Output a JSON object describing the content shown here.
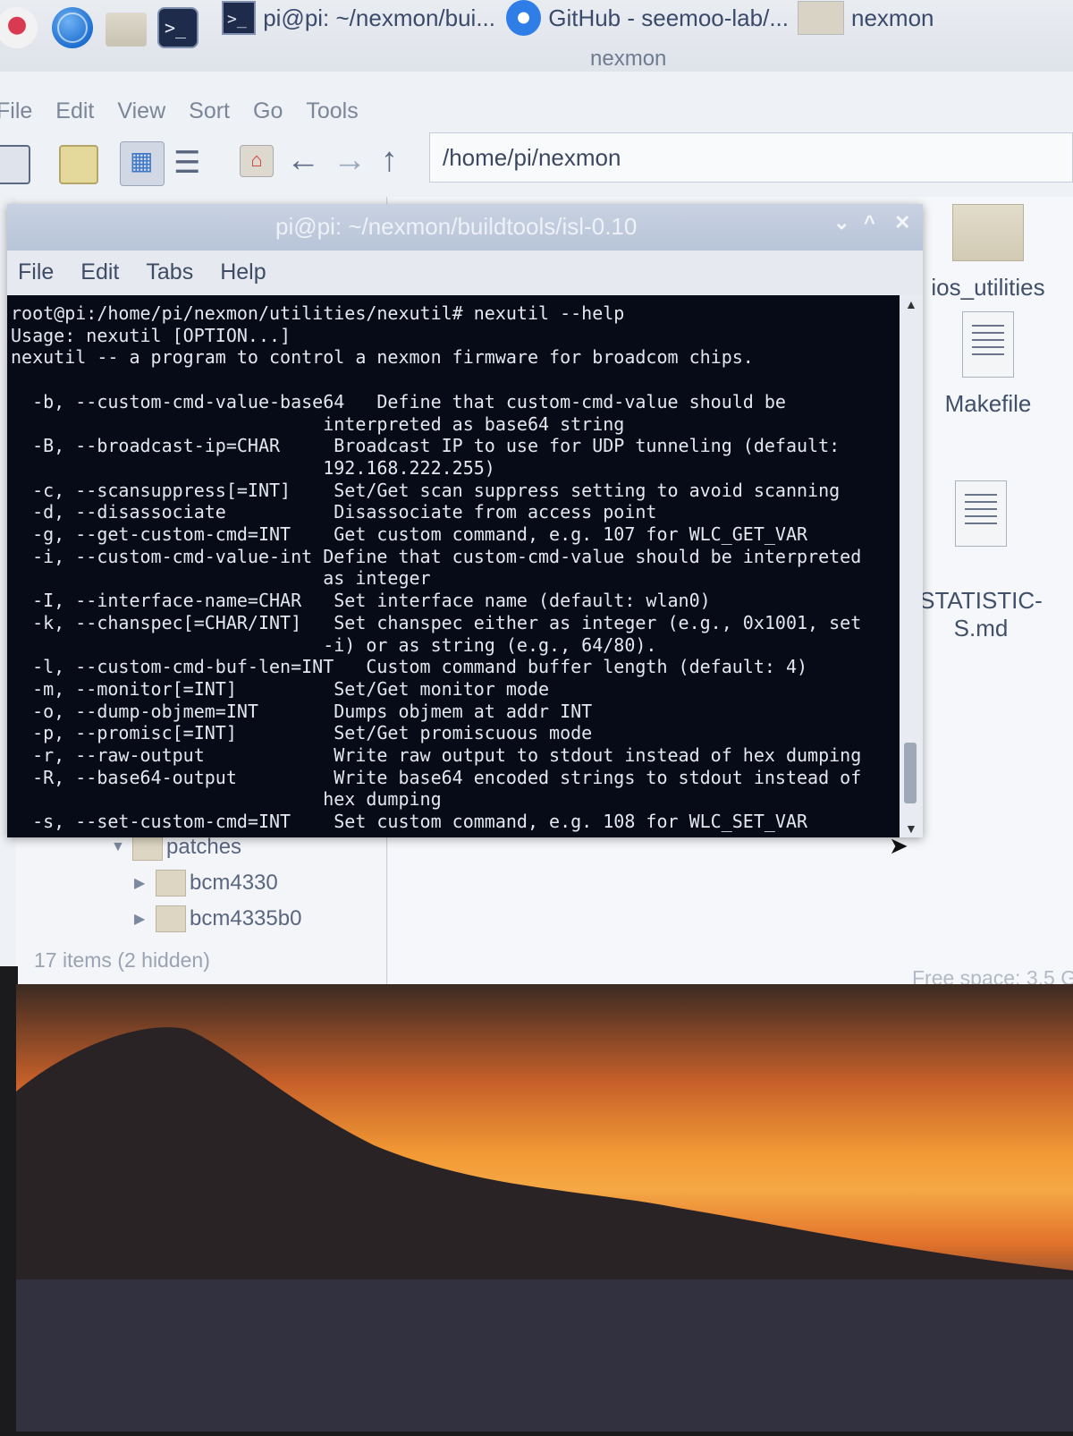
{
  "taskbar": {
    "icons": [
      "raspberry-icon",
      "globe-icon",
      "folder-icon",
      "terminal-icon"
    ],
    "tasks": [
      {
        "icon": "terminal-icon",
        "label": "pi@pi: ~/nexmon/bui..."
      },
      {
        "icon": "chrome-icon",
        "label": "GitHub - seemoo-lab/..."
      },
      {
        "icon": "folder-icon",
        "label": "nexmon"
      }
    ]
  },
  "file_manager": {
    "window_title": "nexmon",
    "menu": [
      "File",
      "Edit",
      "View",
      "Sort",
      "Go",
      "Tools"
    ],
    "path": "/home/pi/nexmon",
    "tree": [
      {
        "label": "patches",
        "expanded": true
      },
      {
        "label": "bcm4330",
        "expanded": false
      },
      {
        "label": "bcm4335b0",
        "expanded": false
      }
    ],
    "files": [
      {
        "name": "ios_utilities",
        "type": "folder"
      },
      {
        "name": "Makefile",
        "type": "file"
      },
      {
        "name": "STATISTIC-\nS.md",
        "type": "file"
      }
    ],
    "status_items": "17 items (2 hidden)",
    "free_space": "Free space: 3.5 G"
  },
  "terminal": {
    "title": "pi@pi: ~/nexmon/buildtools/isl-0.10",
    "menu": [
      "File",
      "Edit",
      "Tabs",
      "Help"
    ],
    "lines": [
      "root@pi:/home/pi/nexmon/utilities/nexutil# nexutil --help",
      "Usage: nexutil [OPTION...]",
      "nexutil -- a program to control a nexmon firmware for broadcom chips.",
      "",
      "  -b, --custom-cmd-value-base64   Define that custom-cmd-value should be",
      "                             interpreted as base64 string",
      "  -B, --broadcast-ip=CHAR     Broadcast IP to use for UDP tunneling (default:",
      "                             192.168.222.255)",
      "  -c, --scansuppress[=INT]    Set/Get scan suppress setting to avoid scanning",
      "  -d, --disassociate          Disassociate from access point",
      "  -g, --get-custom-cmd=INT    Get custom command, e.g. 107 for WLC_GET_VAR",
      "  -i, --custom-cmd-value-int Define that custom-cmd-value should be interpreted",
      "                             as integer",
      "  -I, --interface-name=CHAR   Set interface name (default: wlan0)",
      "  -k, --chanspec[=CHAR/INT]   Set chanspec either as integer (e.g., 0x1001, set",
      "                             -i) or as string (e.g., 64/80).",
      "  -l, --custom-cmd-buf-len=INT   Custom command buffer length (default: 4)",
      "  -m, --monitor[=INT]         Set/Get monitor mode",
      "  -o, --dump-objmem=INT       Dumps objmem at addr INT",
      "  -p, --promisc[=INT]         Set/Get promiscuous mode",
      "  -r, --raw-output            Write raw output to stdout instead of hex dumping",
      "  -R, --base64-output         Write base64 encoded strings to stdout instead of",
      "                             hex dumping",
      "  -s, --set-custom-cmd=INT    Set custom command, e.g. 108 for WLC_SET_VAR"
    ]
  },
  "colors": {
    "terminal_bg": "#070b17",
    "terminal_fg": "#e4e7ee",
    "titlebar": "#b8c4d8"
  }
}
